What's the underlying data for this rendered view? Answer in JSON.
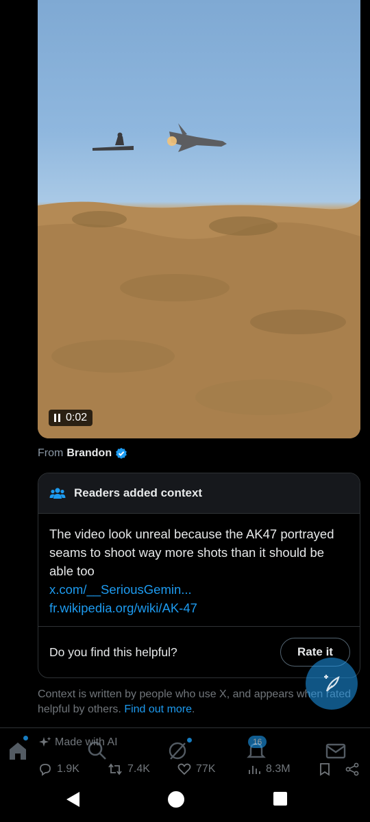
{
  "video": {
    "timestamp": "0:02"
  },
  "source": {
    "prefix": "From",
    "author": "Brandon"
  },
  "community_note": {
    "header": "Readers added context",
    "text": "The video look unreal because the AK47 portrayed seams to shoot way more shots than it should be able too",
    "links": [
      "x.com/__SeriousGemin...",
      "fr.wikipedia.org/wiki/AK-47"
    ],
    "helpful_question": "Do you find this helpful?",
    "rate_label": "Rate it"
  },
  "disclaimer": {
    "text": "Context is written by people who use X, and appears when rated helpful by others.",
    "link": "Find out more",
    "end": "."
  },
  "ai_label": "Made with AI",
  "actions": {
    "replies": "1.9K",
    "reposts": "7.4K",
    "likes": "77K",
    "views": "8.3M"
  },
  "nav": {
    "notifications_badge": "16"
  },
  "colors": {
    "accent": "#1d9bf0",
    "background": "#000000",
    "text": "#e7e9ea",
    "muted": "#71767b"
  }
}
